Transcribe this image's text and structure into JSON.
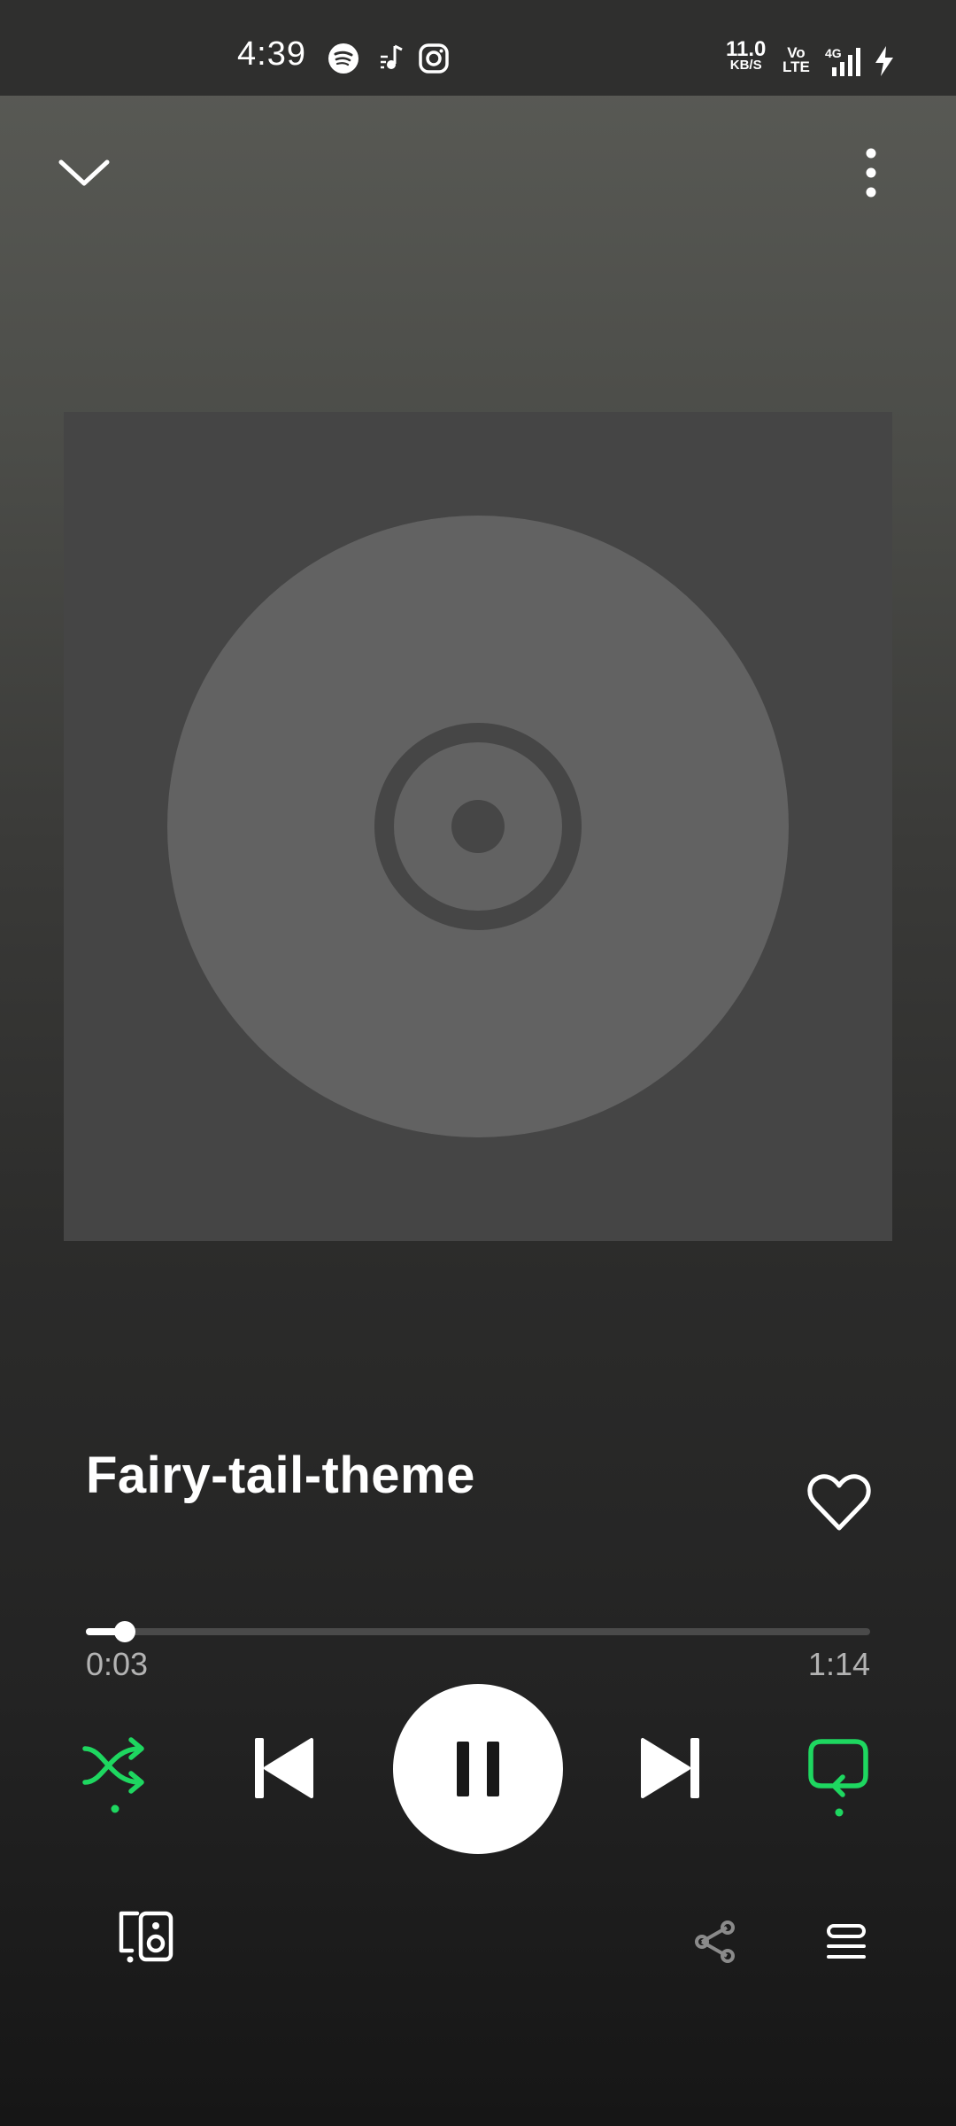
{
  "status_bar": {
    "time": "4:39",
    "net_speed_value": "11.0",
    "net_speed_unit": "KB/S",
    "volte_top": "Vo",
    "volte_bottom": "LTE",
    "network_type": "4G",
    "notification_icons": [
      "spotify-icon",
      "music-note-icon",
      "instagram-icon"
    ],
    "indicator_icons": [
      "signal-icon",
      "charging-icon"
    ]
  },
  "header": {
    "collapse_icon": "chevron-down-icon",
    "menu_icon": "more-vertical-icon"
  },
  "album_art": {
    "placeholder_icon": "disc-icon"
  },
  "track": {
    "title": "Fairy-tail-theme",
    "liked": false
  },
  "progress": {
    "elapsed": "0:03",
    "duration": "1:14",
    "fraction": 0.05
  },
  "controls": {
    "shuffle_active": true,
    "repeat_active": true,
    "playing": true
  },
  "colors": {
    "accent": "#1ed760",
    "primary_text": "#ffffff",
    "secondary_text": "#b3b3b3"
  }
}
